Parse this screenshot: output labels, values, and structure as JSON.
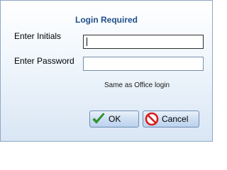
{
  "dialog": {
    "title": "Login Required",
    "initials_label": "Enter Initials",
    "password_label": "Enter Password",
    "initials_value": "",
    "password_value": "",
    "hint": "Same as Office login"
  },
  "buttons": {
    "ok_label": "OK",
    "ok_icon": "checkmark-icon",
    "cancel_label": "Cancel",
    "cancel_icon": "no-entry-icon"
  },
  "colors": {
    "title": "#1f4f8a",
    "ok_check": "#2ea52a",
    "cancel_circle": "#d42020"
  }
}
